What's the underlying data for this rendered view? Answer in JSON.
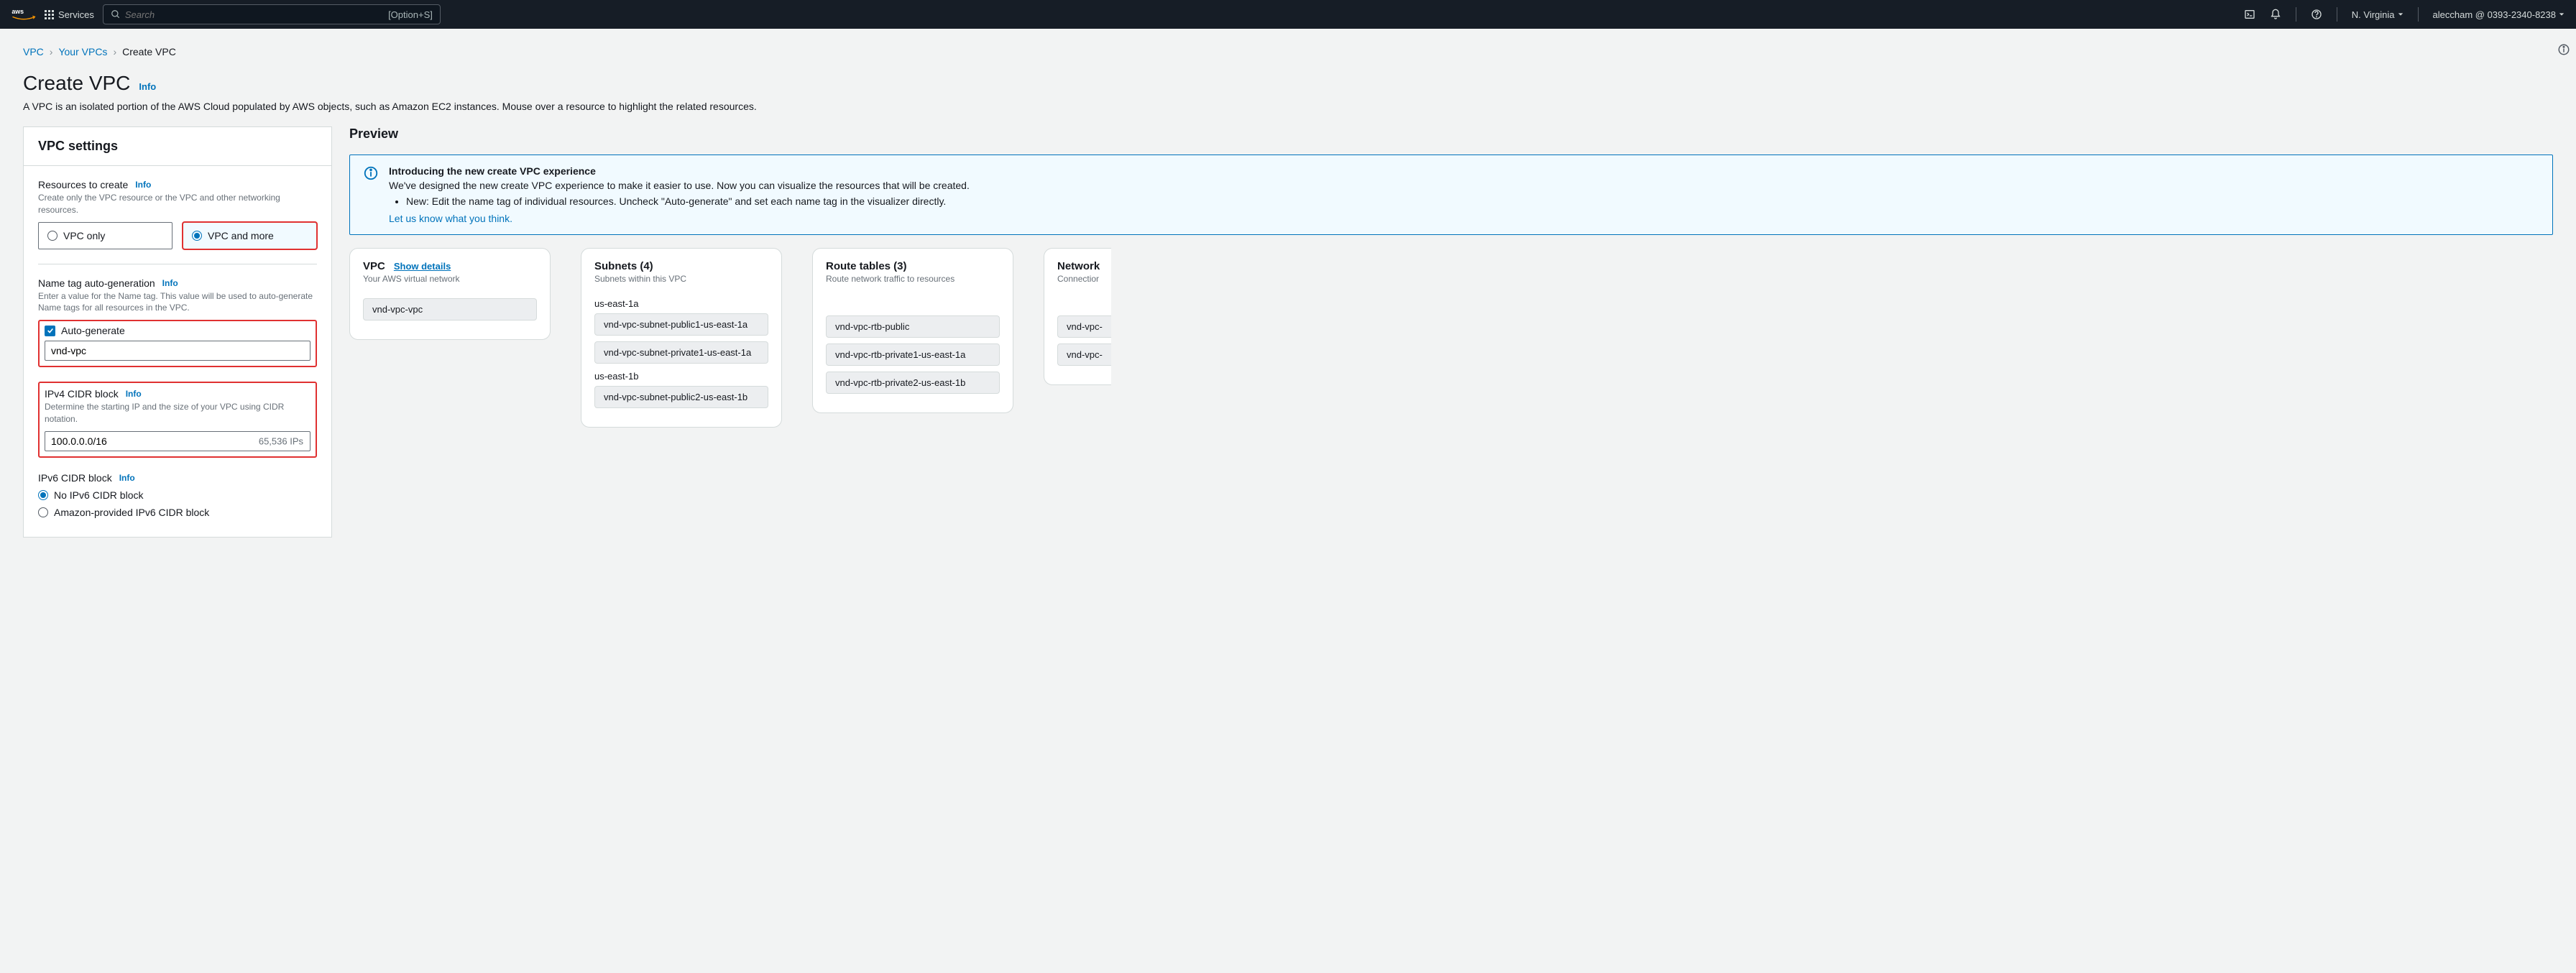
{
  "nav": {
    "services": "Services",
    "search_placeholder": "Search",
    "search_shortcut": "[Option+S]",
    "region": "N. Virginia",
    "account": "aleccham @ 0393-2340-8238"
  },
  "breadcrumb": {
    "vpc": "VPC",
    "yourvpcs": "Your VPCs",
    "create": "Create VPC"
  },
  "header": {
    "title": "Create VPC",
    "info": "Info",
    "desc": "A VPC is an isolated portion of the AWS Cloud populated by AWS objects, such as Amazon EC2 instances. Mouse over a resource to highlight the related resources."
  },
  "settings": {
    "panel_title": "VPC settings",
    "resources_label": "Resources to create",
    "resources_hint": "Create only the VPC resource or the VPC and other networking resources.",
    "vpc_only": "VPC only",
    "vpc_more": "VPC and more",
    "nametag_label": "Name tag auto-generation",
    "nametag_hint": "Enter a value for the Name tag. This value will be used to auto-generate Name tags for all resources in the VPC.",
    "autogen": "Auto-generate",
    "name_value": "vnd-vpc",
    "ipv4_label": "IPv4 CIDR block",
    "ipv4_hint": "Determine the starting IP and the size of your VPC using CIDR notation.",
    "ipv4_value": "100.0.0.0/16",
    "ipv4_suffix": "65,536 IPs",
    "ipv6_label": "IPv6 CIDR block",
    "ipv6_none": "No IPv6 CIDR block",
    "ipv6_aws": "Amazon-provided IPv6 CIDR block",
    "info": "Info"
  },
  "preview": {
    "title": "Preview",
    "banner_title": "Introducing the new create VPC experience",
    "banner_body": "We've designed the new create VPC experience to make it easier to use. Now you can visualize the resources that will be created.",
    "banner_bullet": "New: Edit the name tag of individual resources. Uncheck \"Auto-generate\" and set each name tag in the visualizer directly.",
    "banner_link": "Let us know what you think.",
    "cols": {
      "vpc": {
        "title": "VPC",
        "link": "Show details",
        "sub": "Your AWS virtual network",
        "item": "vnd-vpc-vpc"
      },
      "subnets": {
        "title": "Subnets (4)",
        "sub": "Subnets within this VPC",
        "az1": "us-east-1a",
        "az1_items": [
          "vnd-vpc-subnet-public1-us-east-1a",
          "vnd-vpc-subnet-private1-us-east-1a"
        ],
        "az2": "us-east-1b",
        "az2_items": [
          "vnd-vpc-subnet-public2-us-east-1b"
        ]
      },
      "rtb": {
        "title": "Route tables (3)",
        "sub": "Route network traffic to resources",
        "items": [
          "vnd-vpc-rtb-public",
          "vnd-vpc-rtb-private1-us-east-1a",
          "vnd-vpc-rtb-private2-us-east-1b"
        ]
      },
      "net": {
        "title": "Network",
        "sub": "Connectior",
        "items": [
          "vnd-vpc-",
          "vnd-vpc-"
        ]
      }
    }
  }
}
